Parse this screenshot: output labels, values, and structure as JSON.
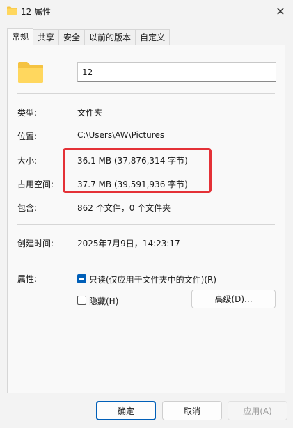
{
  "window": {
    "title": "12 属性",
    "close_glyph": "✕"
  },
  "tabs": [
    {
      "label": "常规",
      "active": true
    },
    {
      "label": "共享"
    },
    {
      "label": "安全"
    },
    {
      "label": "以前的版本"
    },
    {
      "label": "自定义"
    }
  ],
  "general": {
    "name_value": "12",
    "type": {
      "label": "类型:",
      "value": "文件夹"
    },
    "location": {
      "label": "位置:",
      "value": "C:\\Users\\AW\\Pictures"
    },
    "size": {
      "label": "大小:",
      "value": "36.1 MB (37,876,314 字节)"
    },
    "size_on_disk": {
      "label": "占用空间:",
      "value": "37.7 MB (39,591,936 字节)"
    },
    "contains": {
      "label": "包含:",
      "value": "862 个文件，0 个文件夹"
    },
    "created": {
      "label": "创建时间:",
      "value": "2025年7月9日，14:23:17"
    },
    "attributes": {
      "label": "属性:",
      "readonly": {
        "label": "只读(仅应用于文件夹中的文件)(R)",
        "state": "indeterminate"
      },
      "hidden": {
        "label": "隐藏(H)",
        "checked": false
      },
      "advanced_label": "高级(D)..."
    }
  },
  "footer": {
    "ok": "确定",
    "cancel": "取消",
    "apply": "应用(A)"
  },
  "colors": {
    "accent": "#005fb8",
    "highlight_box": "#e43137",
    "folder": "#f5c342"
  }
}
